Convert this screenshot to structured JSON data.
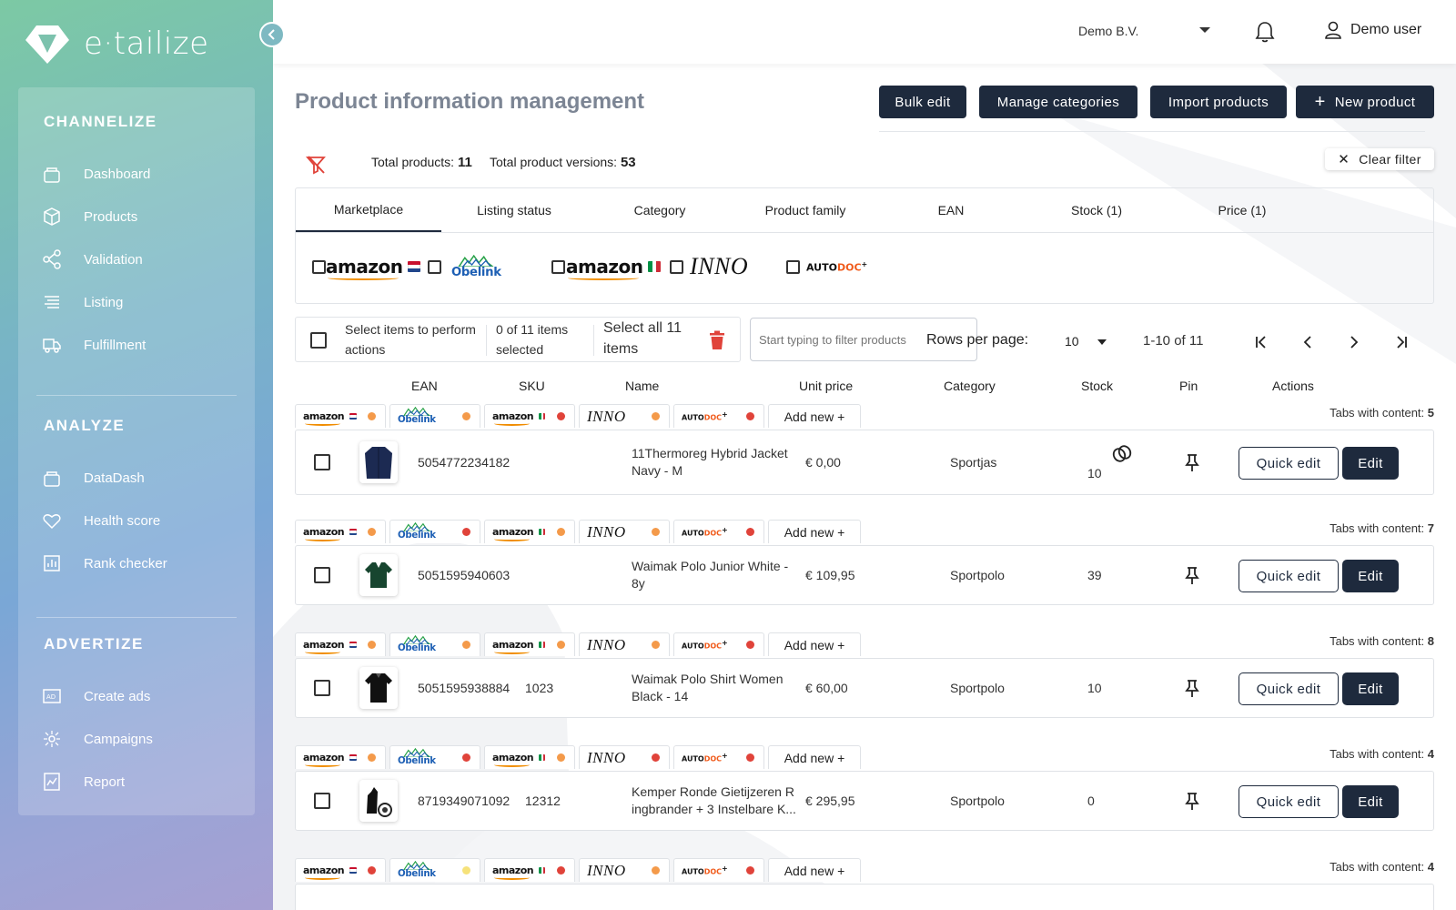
{
  "brand": {
    "name": "e·tailize",
    "logo_icon": "etailize-logo-icon"
  },
  "sidebar": {
    "sections": [
      {
        "title": "CHANNELIZE",
        "items": [
          {
            "label": "Dashboard",
            "icon": "dashboard-icon"
          },
          {
            "label": "Products",
            "icon": "box-icon"
          },
          {
            "label": "Validation",
            "icon": "share-icon"
          },
          {
            "label": "Listing",
            "icon": "list-icon"
          },
          {
            "label": "Fulfillment",
            "icon": "truck-icon"
          }
        ]
      },
      {
        "title": "ANALYZE",
        "items": [
          {
            "label": "DataDash",
            "icon": "datadash-icon"
          },
          {
            "label": "Health score",
            "icon": "heart-icon"
          },
          {
            "label": "Rank checker",
            "icon": "bar-chart-icon"
          }
        ]
      },
      {
        "title": "ADVERTIZE",
        "items": [
          {
            "label": "Create ads",
            "icon": "ad-icon"
          },
          {
            "label": "Campaigns",
            "icon": "campaign-icon"
          },
          {
            "label": "Report",
            "icon": "report-icon"
          }
        ]
      }
    ]
  },
  "topbar": {
    "company": "Demo B.V.",
    "user": "Demo user"
  },
  "page": {
    "title": "Product information management",
    "buttons": {
      "bulk_edit": "Bulk edit",
      "manage_categories": "Manage categories",
      "import_products": "Import products",
      "new_product": "New product"
    },
    "totals": {
      "products_label": "Total products:",
      "products_value": "11",
      "versions_label": "Total product versions:",
      "versions_value": "53"
    },
    "clear_filter": "Clear filter"
  },
  "filter_tabs": [
    "Marketplace",
    "Listing status",
    "Category",
    "Product family",
    "EAN",
    "Stock (1)",
    "Price (1)"
  ],
  "marketplaces": [
    {
      "name": "amazon",
      "flag": "NL"
    },
    {
      "name": "Obelink"
    },
    {
      "name": "amazon",
      "flag": "IT"
    },
    {
      "name": "INNO"
    },
    {
      "name": "AUTODOC"
    }
  ],
  "toolbar": {
    "select_hint": "Select items to perform actions",
    "selected": "0 of 11 items selected",
    "select_all": "Select all 11 items",
    "filter_placeholder": "Start typing to filter products",
    "rows_per_page_label": "Rows per page:",
    "rows_per_page": "10",
    "range": "1-10 of 11"
  },
  "columns": [
    "EAN",
    "SKU",
    "Name",
    "Unit price",
    "Category",
    "Stock",
    "Pin",
    "Actions"
  ],
  "row_labels": {
    "add_new": "Add new",
    "tabs_with_content": "Tabs with content:",
    "quick_edit": "Quick edit",
    "edit": "Edit"
  },
  "status_colors": {
    "orange": "#f49a4a",
    "red": "#e0433a",
    "yellow": "#f6e27a"
  },
  "products": [
    {
      "ean": "5054772234182",
      "sku": "",
      "name_l1": "11Thermoreg Hybrid Jacket",
      "name_l2": "Navy - M",
      "price": "€ 0,00",
      "category": "Sportjas",
      "stock": "10",
      "tabs_count": "5",
      "dots": [
        "orange",
        "orange",
        "red",
        "orange",
        "red"
      ]
    },
    {
      "ean": "5051595940603",
      "sku": "",
      "name_l1": "Waimak Polo Junior White -",
      "name_l2": "8y",
      "price": "€ 109,95",
      "category": "Sportpolo",
      "stock": "39",
      "tabs_count": "7",
      "dots": [
        "orange",
        "red",
        "orange",
        "orange",
        "red"
      ]
    },
    {
      "ean": "5051595938884",
      "sku": "1023",
      "name_l1": "Waimak Polo Shirt Women",
      "name_l2": "Black - 14",
      "price": "€ 60,00",
      "category": "Sportpolo",
      "stock": "10",
      "tabs_count": "8",
      "dots": [
        "orange",
        "orange",
        "orange",
        "orange",
        "red"
      ]
    },
    {
      "ean": "8719349071092",
      "sku": "12312",
      "name_l1": "Kemper Ronde Gietijzeren R",
      "name_l2": "ingbrander + 3 Instelbare K...",
      "price": "€ 295,95",
      "category": "Sportpolo",
      "stock": "0",
      "tabs_count": "4",
      "dots": [
        "orange",
        "red",
        "orange",
        "red",
        "red"
      ]
    },
    {
      "ean": "",
      "sku": "",
      "name_l1": "",
      "name_l2": "",
      "price": "",
      "category": "",
      "stock": "",
      "tabs_count": "4",
      "dots": [
        "red",
        "yellow",
        "red",
        "orange",
        "red"
      ]
    }
  ]
}
